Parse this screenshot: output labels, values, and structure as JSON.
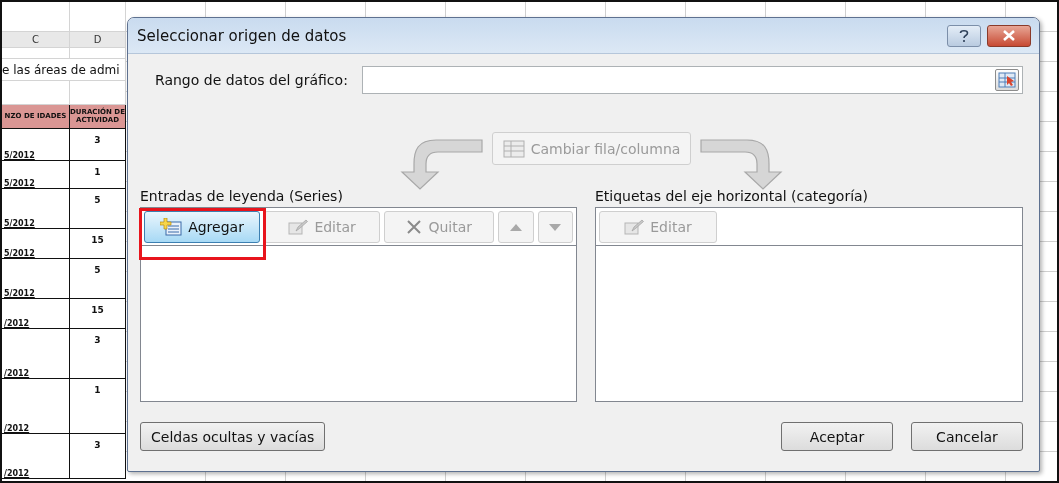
{
  "spreadsheet": {
    "columns": [
      "C",
      "D"
    ],
    "title_fragment": "e las áreas de admi",
    "header": [
      "NZO DE IDADES",
      "DURACIÓN DE ACTIVIDAD"
    ],
    "rows": [
      {
        "date": "5/2012",
        "duration": "3"
      },
      {
        "date": "5/2012",
        "duration": "1"
      },
      {
        "date": "5/2012",
        "duration": "5"
      },
      {
        "date": "5/2012",
        "duration": "15"
      },
      {
        "date": "5/2012",
        "duration": "5"
      },
      {
        "date": "/2012",
        "duration": "15"
      },
      {
        "date": "/2012",
        "duration": "3"
      },
      {
        "date": "/2012",
        "duration": "1"
      },
      {
        "date": "/2012",
        "duration": "3"
      }
    ]
  },
  "dialog": {
    "title": "Seleccionar origen de datos",
    "range": {
      "label": "Rango de datos del gráfico:"
    },
    "switch_button": {
      "label": "Cambiar fila/columna",
      "disabled": true
    },
    "series": {
      "label": "Entradas de leyenda (Series)",
      "buttons": [
        {
          "kind": "add",
          "label": "Agregar",
          "disabled": false,
          "annotated": true
        },
        {
          "kind": "edit",
          "label": "Editar",
          "disabled": true,
          "annotated": false
        },
        {
          "kind": "remove",
          "label": "Quitar",
          "disabled": true,
          "annotated": false
        },
        {
          "kind": "up",
          "disabled": true,
          "annotated": false
        },
        {
          "kind": "down",
          "disabled": true,
          "annotated": false
        }
      ]
    },
    "categories": {
      "label": "Etiquetas del eje horizontal (categoría)",
      "buttons": [
        {
          "kind": "edit",
          "label": "Editar",
          "disabled": true,
          "annotated": false
        }
      ]
    },
    "footer": {
      "hidden_cells": "Celdas ocultas y vacías",
      "ok": "Aceptar",
      "cancel": "Cancelar"
    }
  }
}
